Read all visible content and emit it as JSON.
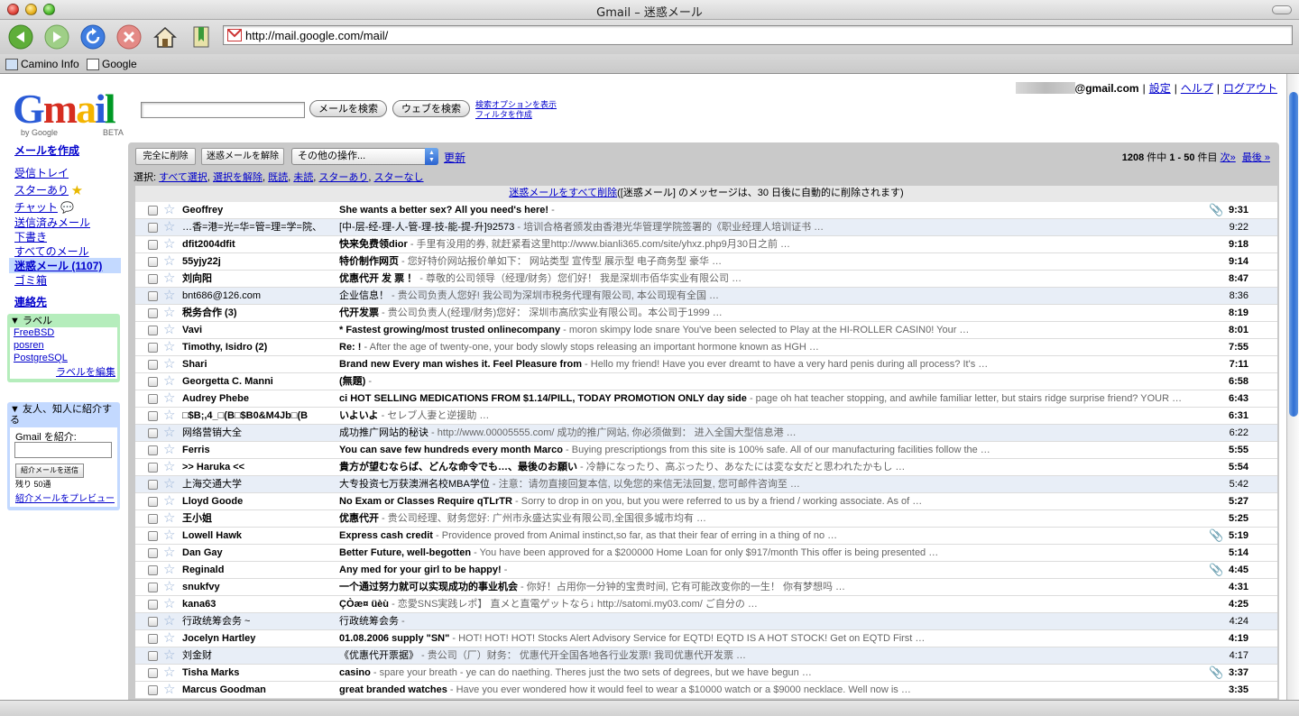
{
  "window": {
    "title": "Gmail – 迷惑メール"
  },
  "toolbar": {
    "url": "http://mail.google.com/mail/"
  },
  "bookmarks": [
    {
      "label": "Camino Info"
    },
    {
      "label": "Google"
    }
  ],
  "header": {
    "logo_text": "Gmail",
    "by_google": "by Google",
    "beta": "BETA",
    "account_suffix": "@gmail.com",
    "links": [
      "設定",
      "ヘルプ",
      "ログアウト"
    ],
    "separator": "|",
    "search_mail_button": "メールを検索",
    "search_web_button": "ウェブを検索",
    "search_options_link": "検索オプションを表示",
    "create_filter_link": "フィルタを作成"
  },
  "nav": {
    "compose": "メールを作成",
    "items": [
      {
        "label": "受信トレイ"
      },
      {
        "label": "スターあり"
      },
      {
        "label": "チャット"
      },
      {
        "label": "送信済みメール"
      },
      {
        "label": "下書き"
      },
      {
        "label": "すべてのメール"
      },
      {
        "label": "迷惑メール (1107)"
      },
      {
        "label": "ゴミ箱"
      }
    ],
    "contacts": "連絡先"
  },
  "labels_box": {
    "title": "▼ ラベル",
    "labels": [
      "FreeBSD",
      "posren",
      "PostgreSQL"
    ],
    "edit_link": "ラベルを編集"
  },
  "invite_box": {
    "title": "▼ 友人、知人に紹介する",
    "prompt": "Gmail を紹介:",
    "send_button": "紹介メールを送信",
    "remaining": "残り 50通",
    "preview_link": "紹介メールをプレビュー"
  },
  "actions": {
    "delete_forever": "完全に削除",
    "not_spam": "迷惑メールを解除",
    "more_actions": "その他の操作...",
    "refresh": "更新",
    "pagination_total": "1208",
    "pagination_text_a": " 件中 ",
    "pagination_range": "1 - 50",
    "pagination_text_b": " 件目 ",
    "next": "次»",
    "last": "最後 »",
    "select_label": "選択:",
    "select_options": [
      "すべて選択",
      "選択を解除",
      "既読",
      "未読",
      "スターあり",
      "スターなし"
    ]
  },
  "spam_notice": {
    "link": "迷惑メールをすべて削除",
    "text": "([迷惑メール] のメッセージは、30 日後に自動的に削除されます)"
  },
  "messages": [
    {
      "from": "Geoffrey",
      "subject": "She wants a better sex? All you need's here!",
      "snippet": " -",
      "time": "9:31",
      "unread": true,
      "attachment": true
    },
    {
      "from": "…香=港=光=华=管=理=学=院、",
      "subject": "[中-层-经-理-人-管-理-技-能-提-升]92573",
      "snippet": " - 培训合格者颁发由香港光华管理学院签署的《职业经理人培训证书 …",
      "time": "9:22",
      "unread": false,
      "attachment": false
    },
    {
      "from": "dfit2004dfit",
      "subject": "快来免费领dior",
      "snippet": " - 手里有没用的券, 就赶紧看这里http://www.bianli365.com/site/yhxz.php9月30日之前 …",
      "time": "9:18",
      "unread": true,
      "attachment": false
    },
    {
      "from": "55yjy22j",
      "subject": "特价制作网页",
      "snippet": " - 您好特价网站报价单如下： 网站类型 宣传型 展示型 电子商务型 豪华 …",
      "time": "9:14",
      "unread": true,
      "attachment": false
    },
    {
      "from": "刘向阳",
      "subject": "优惠代开 发 票 ！",
      "snippet": " - 尊敬的公司领导（经理/财务）您们好！ 我是深圳市佰华实业有限公司 …",
      "time": "8:47",
      "unread": true,
      "attachment": false
    },
    {
      "from": "bnt686@126.com",
      "subject": "企业信息！",
      "snippet": " - 贵公司负责人您好! 我公司为深圳市税务代理有限公司, 本公司现有全国 …",
      "time": "8:36",
      "unread": false,
      "attachment": false
    },
    {
      "from": "税务合作 (3)",
      "subject": "代开发票",
      "snippet": " - 贵公司负责人(经理/财务)您好： 深圳市高欣实业有限公司。本公司于1999 …",
      "time": "8:19",
      "unread": true,
      "attachment": false
    },
    {
      "from": "Vavi",
      "subject": "* Fastest growing/most trusted onlinecompany",
      "snippet": " - moron skimpy lode snare You've been selected to Play at the HI-ROLLER CASIN0! Your …",
      "time": "8:01",
      "unread": true,
      "attachment": false
    },
    {
      "from": "Timothy, Isidro (2)",
      "subject": "Re: !",
      "snippet": " - After the age of twenty-one, your body slowly stops releasing an important hormone known as HGH …",
      "time": "7:55",
      "unread": true,
      "attachment": false
    },
    {
      "from": "Shari",
      "subject": "Brand new Every man wishes it. Feel Pleasure from",
      "snippet": " - Hello my friend! Have you ever dreamt to have a very hard penis during all process? It's …",
      "time": "7:11",
      "unread": true,
      "attachment": false
    },
    {
      "from": "Georgetta C. Manni",
      "subject": "(無題)",
      "snippet": " -",
      "time": "6:58",
      "unread": true,
      "attachment": false
    },
    {
      "from": "Audrey Phebe",
      "subject": "ci HOT SELLING MEDICATIONS FROM $1.14/PILL, TODAY PROMOTION ONLY day side",
      "snippet": " - page oh hat teacher stopping, and awhile familiar letter, but stairs ridge surprise friend? YOUR …",
      "time": "6:43",
      "unread": true,
      "attachment": false
    },
    {
      "from": "□$B;,4_□(B□$B0&M4Jb□(B",
      "subject": "いよいよ",
      "snippet": " - セレブ人妻と逆援助 …",
      "time": "6:31",
      "unread": true,
      "attachment": false
    },
    {
      "from": "网络营销大全",
      "subject": "成功推广网站的秘诀",
      "snippet": " - http://www.00005555.com/ 成功的推广网站, 你必须做到： 进入全国大型信息港 …",
      "time": "6:22",
      "unread": false,
      "attachment": false
    },
    {
      "from": "Ferris",
      "subject": "You can save few hundreds every month Marco",
      "snippet": " - Buying prescriptiongs from this site is 100% safe. All of our manufacturing facilities follow the …",
      "time": "5:55",
      "unread": true,
      "attachment": false
    },
    {
      "from": ">> Haruka <<",
      "subject": "貴方が望むならば、どんな命令でも…、最後のお願い",
      "snippet": " - 冷静になったり、高ぶったり、あなたには変な女だと思われたかもし …",
      "time": "5:54",
      "unread": true,
      "attachment": false
    },
    {
      "from": "上海交通大学",
      "subject": "大专投资七万获澳洲名校MBA学位",
      "snippet": " - 注意：请勿直接回复本信, 以免您的来信无法回复, 您可邮件咨询至 …",
      "time": "5:42",
      "unread": false,
      "attachment": false
    },
    {
      "from": "Lloyd Goode",
      "subject": "No Exam or Classes Require qTLrTR",
      "snippet": " - Sorry to drop in on you, but you were referred to us by a friend / working associate. As of …",
      "time": "5:27",
      "unread": true,
      "attachment": false
    },
    {
      "from": "王小姐",
      "subject": "优惠代开",
      "snippet": " - 贵公司经理、财务您好: 广州市永盛达实业有限公司,全国很多城市均有 …",
      "time": "5:25",
      "unread": true,
      "attachment": false
    },
    {
      "from": "Lowell Hawk",
      "subject": "Express cash credit",
      "snippet": " - Providence proved from Animal instinct,so far, as that their fear of erring in a thing of no …",
      "time": "5:19",
      "unread": true,
      "attachment": true
    },
    {
      "from": "Dan Gay",
      "subject": "Better Future, well-begotten",
      "snippet": " - You have been approved for a $200000 Home Loan for only $917/month This offer is being presented …",
      "time": "5:14",
      "unread": true,
      "attachment": false
    },
    {
      "from": "Reginald",
      "subject": "Any med for your girl to be happy!",
      "snippet": " -",
      "time": "4:45",
      "unread": true,
      "attachment": true
    },
    {
      "from": "snukfvy",
      "subject": "一个通过努力就可以实现成功的事业机会",
      "snippet": " - 你好！占用你一分钟的宝贵时间, 它有可能改变你的一生！ 你有梦想吗 …",
      "time": "4:31",
      "unread": true,
      "attachment": false
    },
    {
      "from": "kana63",
      "subject": "ÇÒæ¤ üèù",
      "snippet": " - 恋愛SNS実践レポ】 直メと直電ゲットなら↓ http://satomi.my03.com/ ご自分の …",
      "time": "4:25",
      "unread": true,
      "attachment": false
    },
    {
      "from": "行政统筹会务 ~",
      "subject": "行政统筹会务",
      "snippet": " -",
      "time": "4:24",
      "unread": false,
      "attachment": false
    },
    {
      "from": "Jocelyn Hartley",
      "subject": "01.08.2006 supply \"SN\"",
      "snippet": " - HOT! HOT! HOT! Stocks Alert Advisory Service for EQTD! EQTD IS A HOT STOCK! Get on EQTD First …",
      "time": "4:19",
      "unread": true,
      "attachment": false
    },
    {
      "from": "刘金财",
      "subject": "《优惠代开票据》",
      "snippet": " - 贵公司（厂）财务： 优惠代开全国各地各行业发票! 我司优惠代开发票 …",
      "time": "4:17",
      "unread": false,
      "attachment": false
    },
    {
      "from": "Tisha Marks",
      "subject": "casino",
      "snippet": " - spare your breath - ye can do naething. Theres just the two sets of degrees, but we have begun …",
      "time": "3:37",
      "unread": true,
      "attachment": true
    },
    {
      "from": "Marcus Goodman",
      "subject": "great branded watches",
      "snippet": " - Have you ever wondered how it would feel to wear a $10000 watch or a $9000 necklace. Well now is …",
      "time": "3:35",
      "unread": true,
      "attachment": false
    }
  ],
  "colors": {
    "nav_active_bg": "#c3d9ff",
    "labels_box_bg": "#b5edbc",
    "invite_box_bg": "#c3d9ff",
    "panel_bg": "#c9c9c9",
    "read_row_bg": "#e8eef7",
    "link": "#0000cc"
  }
}
